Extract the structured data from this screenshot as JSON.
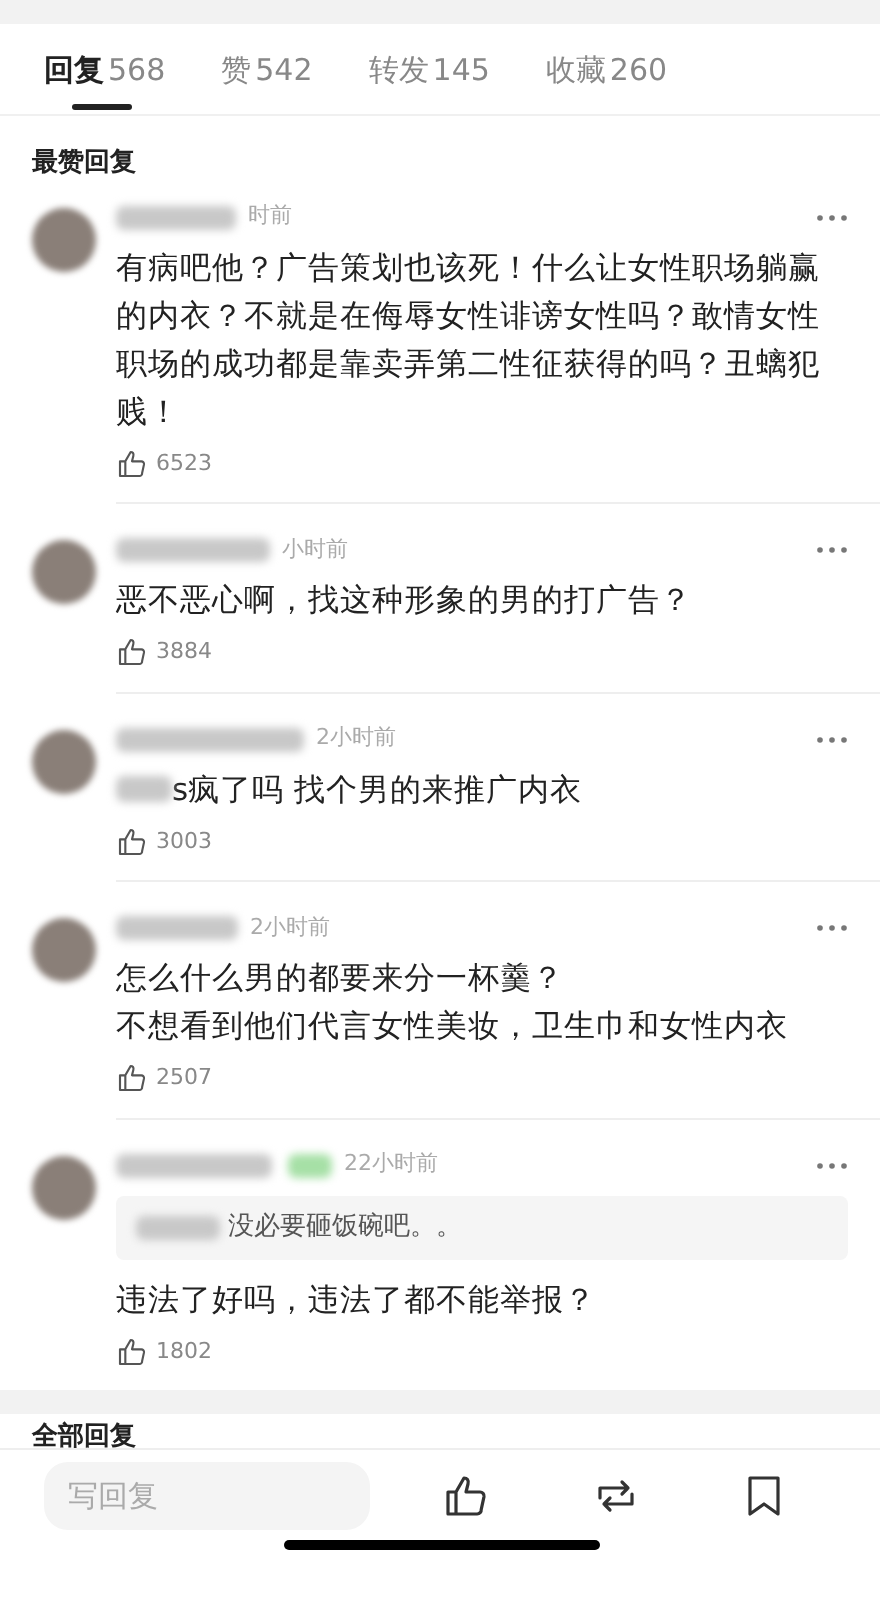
{
  "tabs": [
    {
      "label": "回复",
      "count": "568",
      "selected": true
    },
    {
      "label": "赞",
      "count": "542",
      "selected": false
    },
    {
      "label": "转发",
      "count": "145",
      "selected": false
    },
    {
      "label": "收藏",
      "count": "260",
      "selected": false
    }
  ],
  "top_section_title": "最赞回复",
  "comments": [
    {
      "time": "时前",
      "text": "有病吧他？广告策划也该死！什么让女性职场躺赢的内衣？不就是在侮辱女性诽谤女性吗？敢情女性职场的成功都是靠卖弄第二性征获得的吗？丑螭犯贱！",
      "likes": "6523"
    },
    {
      "time": "小时前",
      "text": "恶不恶心啊，找这种形象的男的打广告？",
      "likes": "3884"
    },
    {
      "time": "2小时前",
      "text": "s疯了吗 找个男的来推广内衣",
      "text_blurred_prefix": true,
      "likes": "3003"
    },
    {
      "time": "2小时前",
      "text": "怎么什么男的都要来分一杯羹？",
      "text_2": "不想看到他们代言女性美妆，卫生巾和女性内衣",
      "likes": "2507"
    },
    {
      "time": "22小时前",
      "badge": true,
      "quote": "没必要砸饭碗吧。。",
      "text": "违法了好吗，违法了都不能举报？",
      "likes": "1802"
    }
  ],
  "all_section_title": "全部回复",
  "reply_field": {
    "placeholder": "写回复"
  }
}
